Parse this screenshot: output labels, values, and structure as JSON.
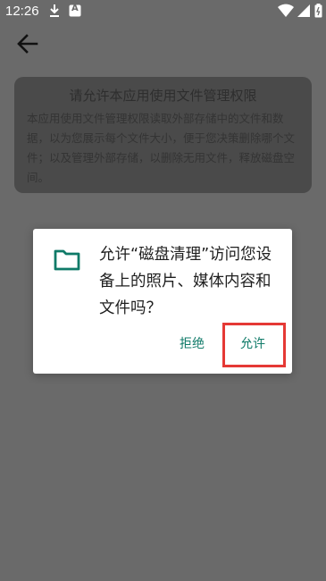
{
  "status_bar": {
    "time": "12:26",
    "icons": [
      "download-icon",
      "notification-a-icon",
      "wifi-icon",
      "signal-icon",
      "battery-icon"
    ],
    "badge_letter": "A"
  },
  "toolbar": {
    "back_icon": "arrow-left-icon"
  },
  "info_card": {
    "title": "请允许本应用使用文件管理权限",
    "body": "本应用使用文件管理权限读取外部存储中的文件和数据，以为您展示每个文件大小，便于您决策删除哪个文件；以及管理外部存储，以删除无用文件，释放磁盘空间。"
  },
  "dialog": {
    "icon": "folder-icon",
    "message": "允许“磁盘清理”访问您设备上的照片、媒体内容和文件吗？",
    "deny_label": "拒绝",
    "allow_label": "允许"
  },
  "colors": {
    "accent": "#0f7a68",
    "highlight": "#e53935",
    "scrim": "#6a6a6a"
  }
}
